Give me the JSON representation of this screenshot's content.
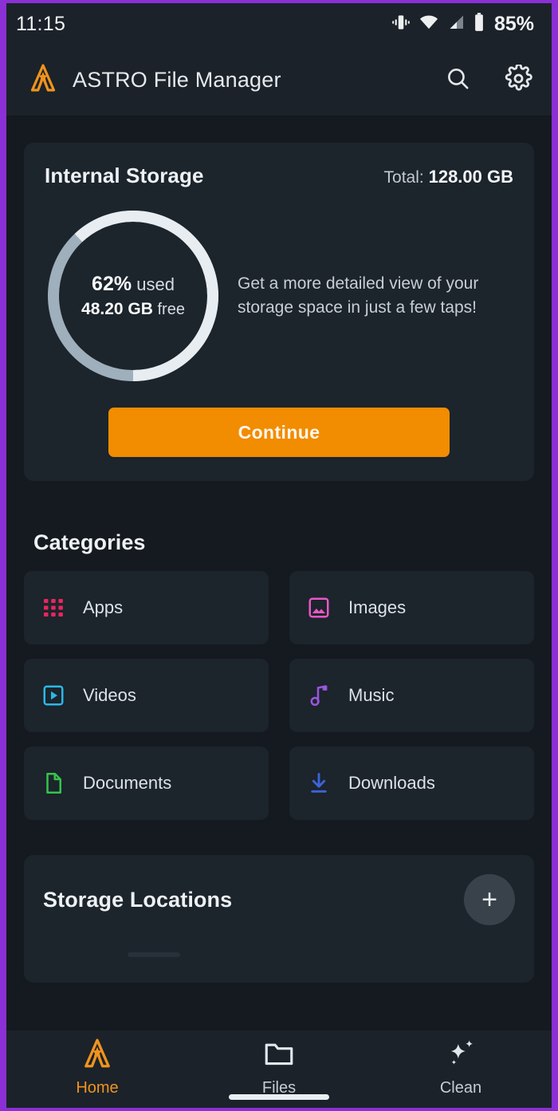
{
  "statusbar": {
    "time": "11:15",
    "battery_percent": "85%",
    "icons": [
      "vibrate-icon",
      "wifi-icon",
      "cellular-signal-icon",
      "battery-icon"
    ]
  },
  "appbar": {
    "logo": "astro-logo-icon",
    "title": "ASTRO File Manager",
    "search_icon": "search-icon",
    "settings_icon": "gear-icon"
  },
  "storage": {
    "title": "Internal Storage",
    "total_label": "Total:",
    "total_value": "128.00 GB",
    "used_percent_value": "62%",
    "used_percent_suffix": "used",
    "free_value": "48.20 GB",
    "free_suffix": "free",
    "blurb": "Get a more detailed view of your storage space in just a few taps!",
    "continue_label": "Continue",
    "accent_color": "#F28C00",
    "ring_used_color": "#E8EDF1",
    "ring_free_color": "#9FAFBC"
  },
  "chart_data": {
    "type": "pie",
    "title": "Internal Storage",
    "categories": [
      "used",
      "free"
    ],
    "values": [
      62,
      38
    ],
    "units": "percent",
    "total_gb": 128.0,
    "used_gb": 79.8,
    "free_gb": 48.2,
    "labels": [
      "62% used",
      "48.20 GB free"
    ],
    "colors": [
      "#E8EDF1",
      "#9FAFBC"
    ],
    "donut": true,
    "start_angle_deg": 0,
    "legend": "none",
    "grid": false
  },
  "categories": {
    "heading": "Categories",
    "items": [
      {
        "label": "Apps",
        "icon": "apps-grid-icon",
        "color": "#E8265E"
      },
      {
        "label": "Images",
        "icon": "image-icon",
        "color": "#E857C6"
      },
      {
        "label": "Videos",
        "icon": "video-play-icon",
        "color": "#2BB8E6"
      },
      {
        "label": "Music",
        "icon": "music-note-icon",
        "color": "#9B55DE"
      },
      {
        "label": "Documents",
        "icon": "document-file-icon",
        "color": "#35C44A"
      },
      {
        "label": "Downloads",
        "icon": "download-icon",
        "color": "#3C63D8"
      }
    ]
  },
  "locations": {
    "title": "Storage Locations",
    "add_label": "+",
    "add_icon": "plus-icon"
  },
  "bottomnav": {
    "items": [
      {
        "label": "Home",
        "icon": "astro-logo-icon",
        "active": true
      },
      {
        "label": "Files",
        "icon": "folder-icon",
        "active": false
      },
      {
        "label": "Clean",
        "icon": "sparkle-icon",
        "active": false
      }
    ],
    "active_color": "#F0931E"
  }
}
